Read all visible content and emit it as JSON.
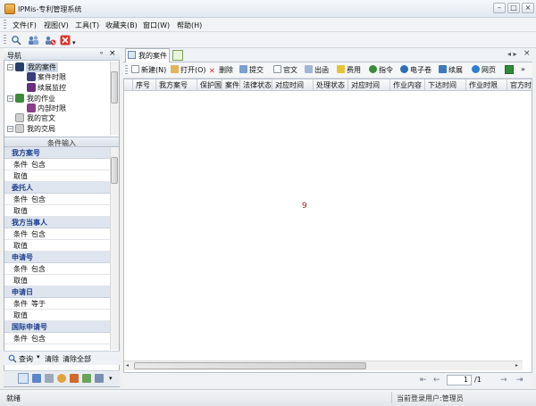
{
  "window": {
    "title": "IPMis-专利管理系统",
    "buttons": [
      "–",
      "□",
      "×"
    ]
  },
  "menu": {
    "items": [
      "文件(F)",
      "视图(V)",
      "工具(T)",
      "收藏夹(B)",
      "窗口(W)",
      "帮助(H)"
    ]
  },
  "toolbar": {
    "icons": [
      "search-icon",
      "users-icon",
      "users-cancel-icon",
      "close-icon"
    ]
  },
  "nav": {
    "title": "导航",
    "pin": "ᵒ",
    "close": "×",
    "tree": [
      {
        "label": "我的案件",
        "level": 0,
        "toggle": "⊟"
      },
      {
        "label": "案件时限",
        "level": 1
      },
      {
        "label": "续展监控",
        "level": 1
      },
      {
        "label": "我的作业",
        "level": 0,
        "toggle": "⊟"
      },
      {
        "label": "内部时限",
        "level": 1
      },
      {
        "label": "我的官文",
        "level": 0
      },
      {
        "label": "我的交局",
        "level": 0,
        "toggle": "⊟"
      }
    ]
  },
  "conditions": {
    "title": "条件输入",
    "groups": [
      {
        "name": "我方案号",
        "rows": [
          {
            "k": "条件",
            "v": "包含"
          },
          {
            "k": "取值",
            "v": ""
          }
        ]
      },
      {
        "name": "委托人",
        "rows": [
          {
            "k": "条件",
            "v": "包含"
          },
          {
            "k": "取值",
            "v": ""
          }
        ]
      },
      {
        "name": "我方当事人",
        "rows": [
          {
            "k": "条件",
            "v": "包含"
          },
          {
            "k": "取值",
            "v": ""
          }
        ]
      },
      {
        "name": "申请号",
        "rows": [
          {
            "k": "条件",
            "v": "包含"
          },
          {
            "k": "取值",
            "v": ""
          }
        ]
      },
      {
        "name": "申请日",
        "rows": [
          {
            "k": "条件",
            "v": "等于"
          },
          {
            "k": "取值",
            "v": ""
          }
        ]
      },
      {
        "name": "国际申请号",
        "rows": [
          {
            "k": "条件",
            "v": "包含"
          }
        ]
      }
    ]
  },
  "left_actions": {
    "query": "查询",
    "clear": "清除",
    "clear_all": "清除全部"
  },
  "tabs": {
    "active": "我的案件"
  },
  "actions": [
    {
      "label": "新建(N)",
      "icon": "new-icon"
    },
    {
      "label": "打开(O)",
      "icon": "open-icon"
    },
    {
      "label": "删除",
      "icon": "delete-icon"
    },
    {
      "label": "提交",
      "icon": "submit-icon"
    },
    {
      "label": "官文",
      "icon": "document-icon"
    },
    {
      "label": "出函",
      "icon": "letter-icon"
    },
    {
      "label": "费用",
      "icon": "fee-icon"
    },
    {
      "label": "指令",
      "icon": "instruction-icon"
    },
    {
      "label": "电子卷",
      "icon": "archive-icon"
    },
    {
      "label": "续展",
      "icon": "renew-icon"
    },
    {
      "label": "网页",
      "icon": "web-icon"
    }
  ],
  "grid": {
    "columns": [
      "序号",
      "我方案号",
      "保护国",
      "案件",
      "法律状态",
      "对应时间",
      "处理状态",
      "对应时间",
      "作业内容",
      "下达时间",
      "作业时限",
      "官方时"
    ],
    "count_text": "9"
  },
  "pager": {
    "page": "1",
    "total": "/1"
  },
  "status": {
    "left": "就绪",
    "right": "当前登录用户:管理员"
  },
  "colors": {
    "accent": "#1c3f8c",
    "count": "#b01717"
  }
}
